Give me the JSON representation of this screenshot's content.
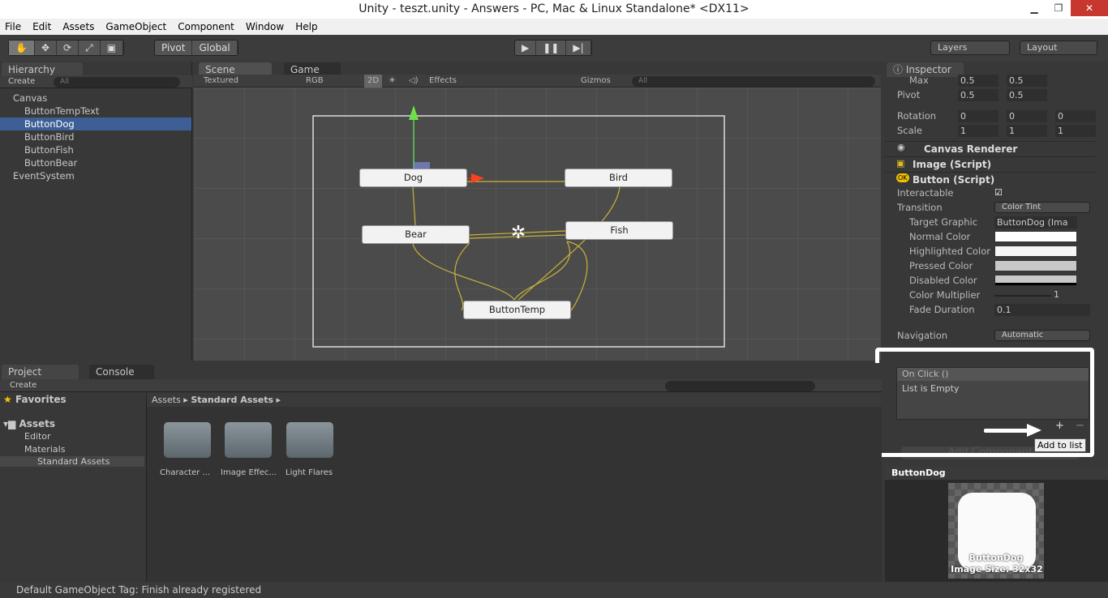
{
  "window": {
    "title": "Unity - teszt.unity - Answers - PC, Mac & Linux Standalone* <DX11>",
    "min": "▁",
    "max": "❐",
    "close": "✕"
  },
  "menu": [
    "File",
    "Edit",
    "Assets",
    "GameObject",
    "Component",
    "Window",
    "Help"
  ],
  "toolbar": {
    "tools": [
      "✋",
      "✥",
      "⟳",
      "⤢",
      "▣"
    ],
    "pivot": "Pivot",
    "global": "Global",
    "play": "▶",
    "pause": "❚❚",
    "step": "▶|",
    "layers": "Layers",
    "layout": "Layout"
  },
  "hierarchy": {
    "tab": "Hierarchy",
    "create": "Create",
    "search": "All",
    "items": [
      {
        "label": "Canvas",
        "indent": 0
      },
      {
        "label": "ButtonTempText",
        "indent": 1
      },
      {
        "label": "ButtonDog",
        "indent": 1,
        "selected": true
      },
      {
        "label": "ButtonBird",
        "indent": 1
      },
      {
        "label": "ButtonFish",
        "indent": 1
      },
      {
        "label": "ButtonBear",
        "indent": 1
      },
      {
        "label": "EventSystem",
        "indent": 0
      }
    ]
  },
  "scene": {
    "tabs": [
      "Scene",
      "Game"
    ],
    "shading": "Textured",
    "render": "RGB",
    "mode2d": "2D",
    "effects": "Effects",
    "gizmos": "Gizmos",
    "search": "All",
    "buttons": {
      "dog": "Dog",
      "bird": "Bird",
      "bear": "Bear",
      "fish": "Fish",
      "temp": "ButtonTemp"
    }
  },
  "inspector": {
    "tab": "Inspector",
    "max": {
      "label": "Max",
      "x": "0.5",
      "y": "0.5"
    },
    "pivot": {
      "label": "Pivot",
      "x": "0.5",
      "y": "0.5"
    },
    "rotation": {
      "label": "Rotation",
      "x": "0",
      "y": "0",
      "z": "0"
    },
    "scale": {
      "label": "Scale",
      "x": "1",
      "y": "1",
      "z": "1"
    },
    "components": [
      "Canvas Renderer",
      "Image (Script)",
      "Button (Script)"
    ],
    "interactable": "Interactable",
    "transition": {
      "label": "Transition",
      "value": "Color Tint"
    },
    "target": {
      "label": "Target Graphic",
      "value": "ButtonDog (Ima"
    },
    "colors": [
      "Normal Color",
      "Highlighted Color",
      "Pressed Color",
      "Disabled Color"
    ],
    "multiplier": {
      "label": "Color Multiplier",
      "value": "1"
    },
    "fade": {
      "label": "Fade Duration",
      "value": "0.1"
    },
    "navigation": {
      "label": "Navigation",
      "value": "Automatic"
    },
    "onclick": "On Click ()",
    "empty": "List is Empty",
    "plus": "+",
    "minus": "−",
    "tooltip": "Add to list",
    "add_component": "Add Component"
  },
  "preview": {
    "title": "ButtonDog",
    "name": "ButtonDog",
    "size": "Image Size: 32x32"
  },
  "project": {
    "tabs": [
      "Project",
      "Console"
    ],
    "create": "Create",
    "favorites": "Favorites",
    "assets": "Assets",
    "tree": [
      "Editor",
      "Materials",
      "Standard Assets"
    ],
    "breadcrumb": [
      "Assets",
      "Standard Assets"
    ],
    "folders": [
      "Character ...",
      "Image Effec...",
      "Light Flares"
    ]
  },
  "status": "Default GameObject Tag: Finish already registered"
}
